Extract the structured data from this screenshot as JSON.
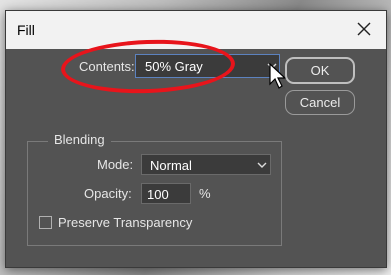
{
  "dialog": {
    "title": "Fill",
    "close_icon": "close-icon"
  },
  "contents": {
    "label": "Contents:",
    "selected": "50% Gray"
  },
  "buttons": {
    "ok_label": "OK",
    "cancel_label": "Cancel"
  },
  "blending": {
    "group_label": "Blending",
    "mode_label": "Mode:",
    "mode_value": "Normal",
    "opacity_label": "Opacity:",
    "opacity_value": "100",
    "opacity_unit": "%",
    "preserve_label": "Preserve Transparency",
    "preserve_checked": false
  },
  "colors": {
    "dialog_bg": "#535353",
    "titlebar_bg": "#f2f2f2",
    "highlight_ring": "#e8141b",
    "focus_border": "#5c82bf"
  }
}
